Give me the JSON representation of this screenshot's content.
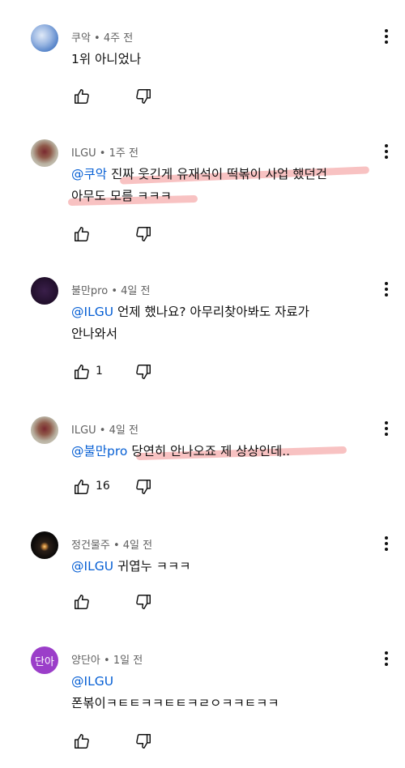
{
  "comments": [
    {
      "author": "쿠악",
      "time": "4주 전",
      "lines": [
        "1위 아니었나"
      ],
      "mention": "",
      "likes": "",
      "avatar": "sky-photo"
    },
    {
      "author": "ILGU",
      "time": "1주 전",
      "mention": "@쿠악",
      "lines": [
        "진짜 웃긴게 유재석이 떡볶이 사업 했던건",
        "아무도 모름 ㅋㅋㅋ"
      ],
      "likes": "",
      "avatar": "rose-photo"
    },
    {
      "author": "불만pro",
      "time": "4일 전",
      "mention": "@ILGU",
      "lines": [
        "언제 했나요? 아무리찾아봐도 자료가",
        "안나와서"
      ],
      "likes": "1",
      "avatar": "dark-purple"
    },
    {
      "author": "ILGU",
      "time": "4일 전",
      "mention": "@불만pro",
      "lines": [
        "당연히 안나오죠 제 상상인데.."
      ],
      "likes": "16",
      "avatar": "rose-photo"
    },
    {
      "author": "정건물주",
      "time": "4일 전",
      "mention": "@ILGU",
      "lines": [
        "귀엽누 ㅋㅋㅋ"
      ],
      "likes": "",
      "avatar": "dark-light"
    },
    {
      "author": "양단아",
      "time": "1일 전",
      "mention": "@ILGU",
      "lines": [
        "",
        "폰볶이ㅋㅌㅌㅋㅋㅌㅌㅋㄹㅇㅋㅋㅌㅋㅋ"
      ],
      "likes": "",
      "avatar_text": "단아",
      "avatar": "purple-initials"
    }
  ],
  "separator": " • ",
  "icons": {
    "like": "thumbs-up-icon",
    "dislike": "thumbs-down-icon",
    "menu": "more-vert-icon"
  },
  "colors": {
    "mention": "#065fd4",
    "highlight": "#f07878",
    "avatar_purple": "#9b3ec9"
  }
}
